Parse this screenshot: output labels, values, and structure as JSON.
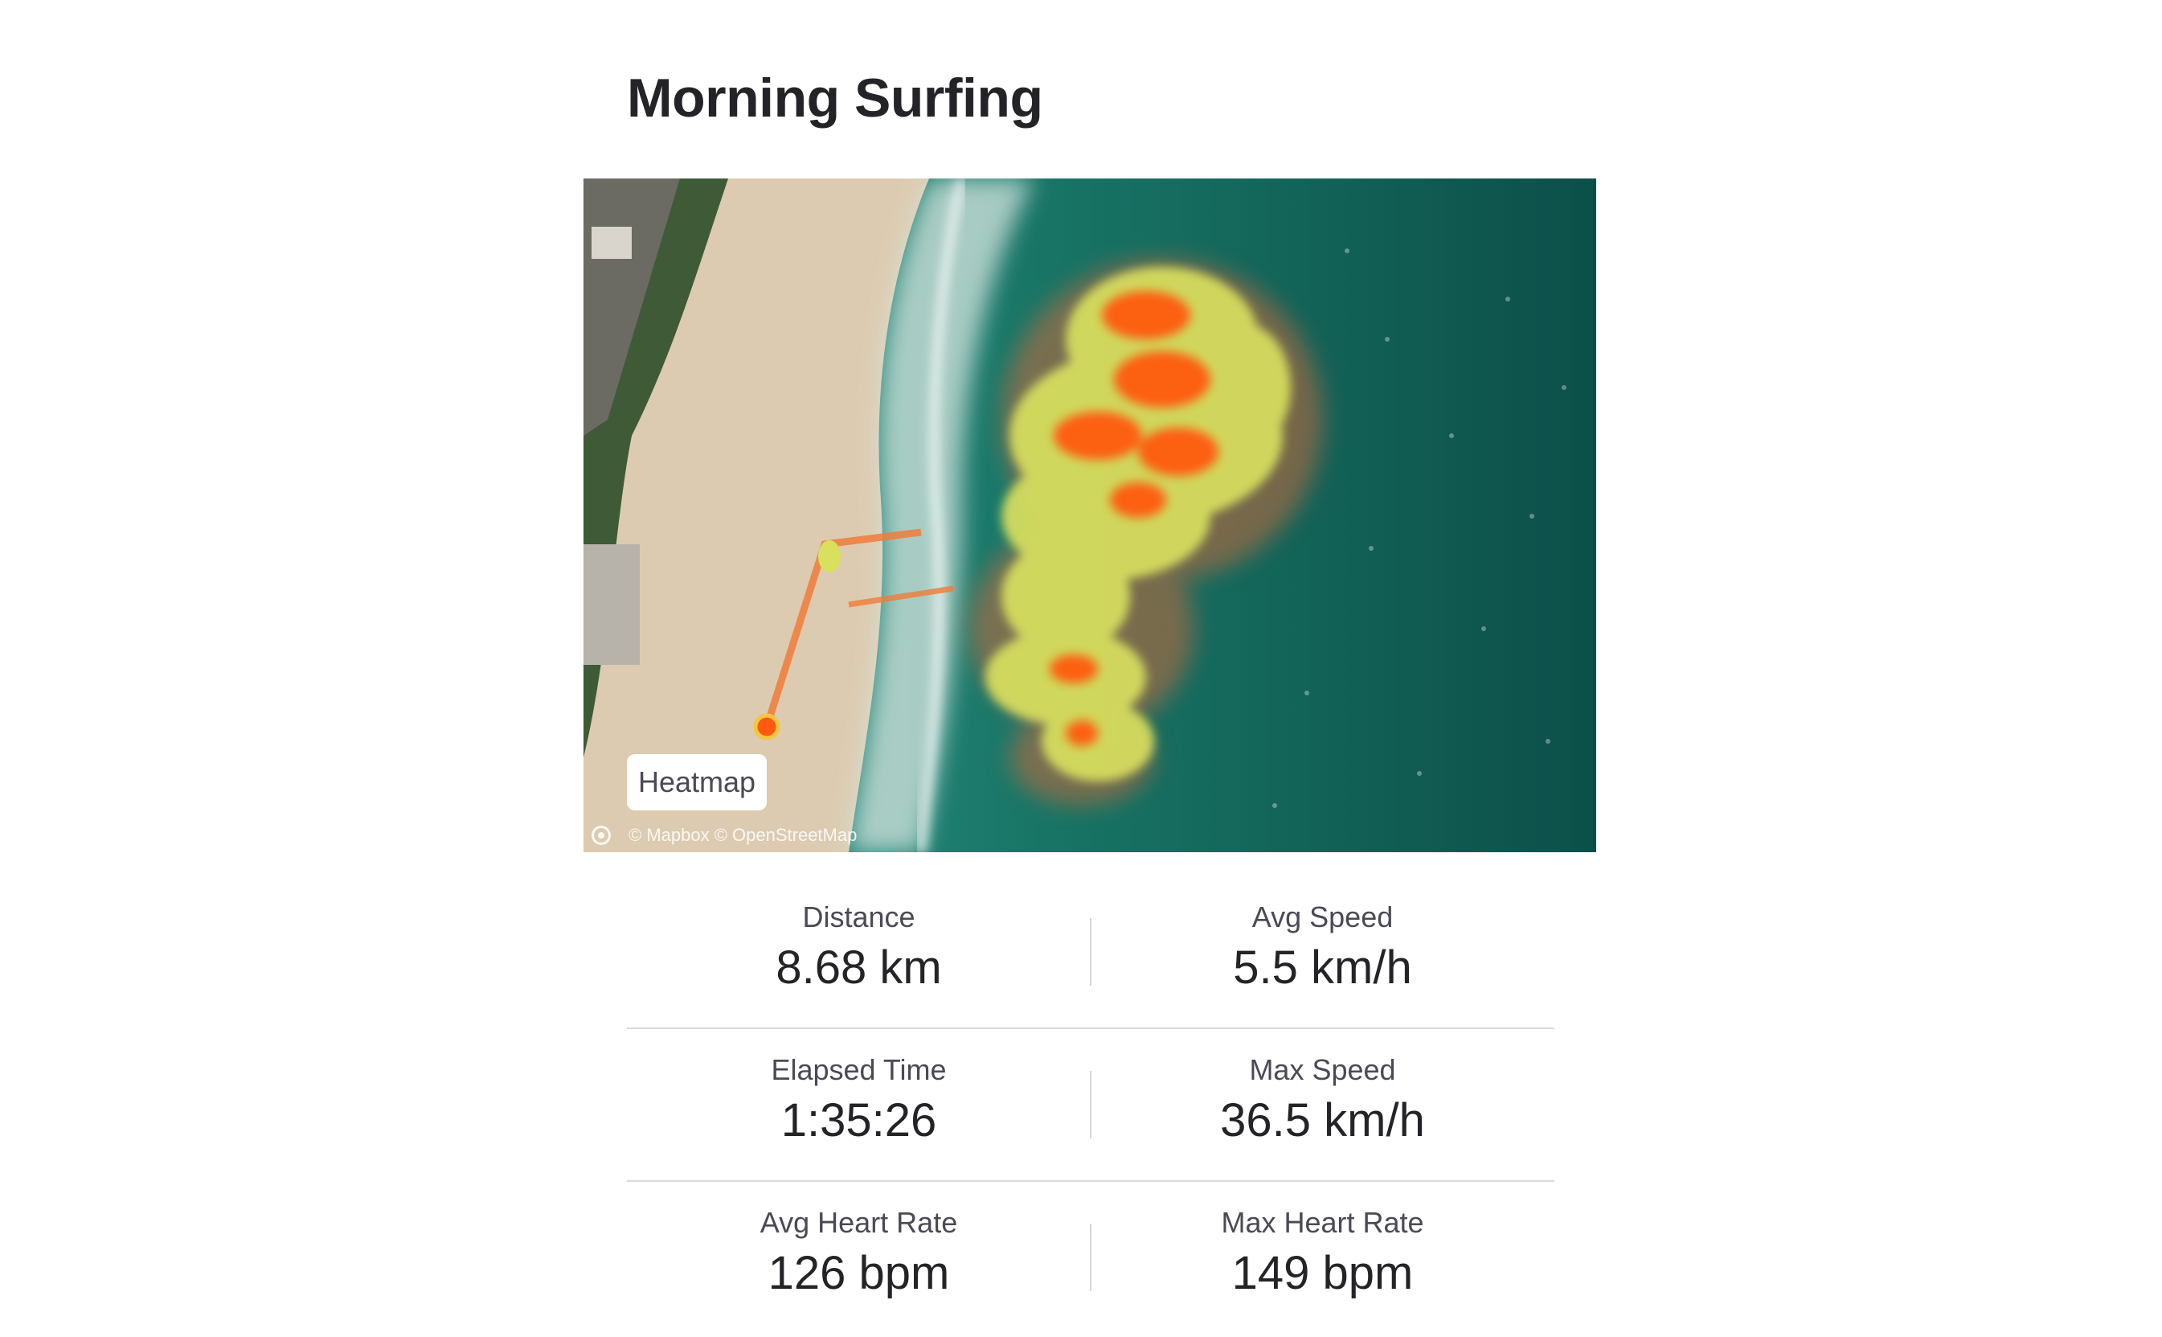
{
  "activity": {
    "title": "Morning Surfing"
  },
  "map": {
    "layer_label": "Heatmap",
    "attribution": "© Mapbox © OpenStreetMap",
    "logo_icon": "mapbox-logo-icon",
    "colors": {
      "sea": "#0f5c53",
      "sand": "#dfcfb4",
      "heat_high": "#ff5a10",
      "heat_mid": "#d9e05a"
    }
  },
  "stats": [
    {
      "left": {
        "label": "Distance",
        "value": "8.68 km"
      },
      "right": {
        "label": "Avg Speed",
        "value": "5.5 km/h"
      }
    },
    {
      "left": {
        "label": "Elapsed Time",
        "value": "1:35:26"
      },
      "right": {
        "label": "Max Speed",
        "value": "36.5 km/h"
      }
    },
    {
      "left": {
        "label": "Avg Heart Rate",
        "value": "126 bpm"
      },
      "right": {
        "label": "Max Heart Rate",
        "value": "149 bpm"
      }
    }
  ]
}
